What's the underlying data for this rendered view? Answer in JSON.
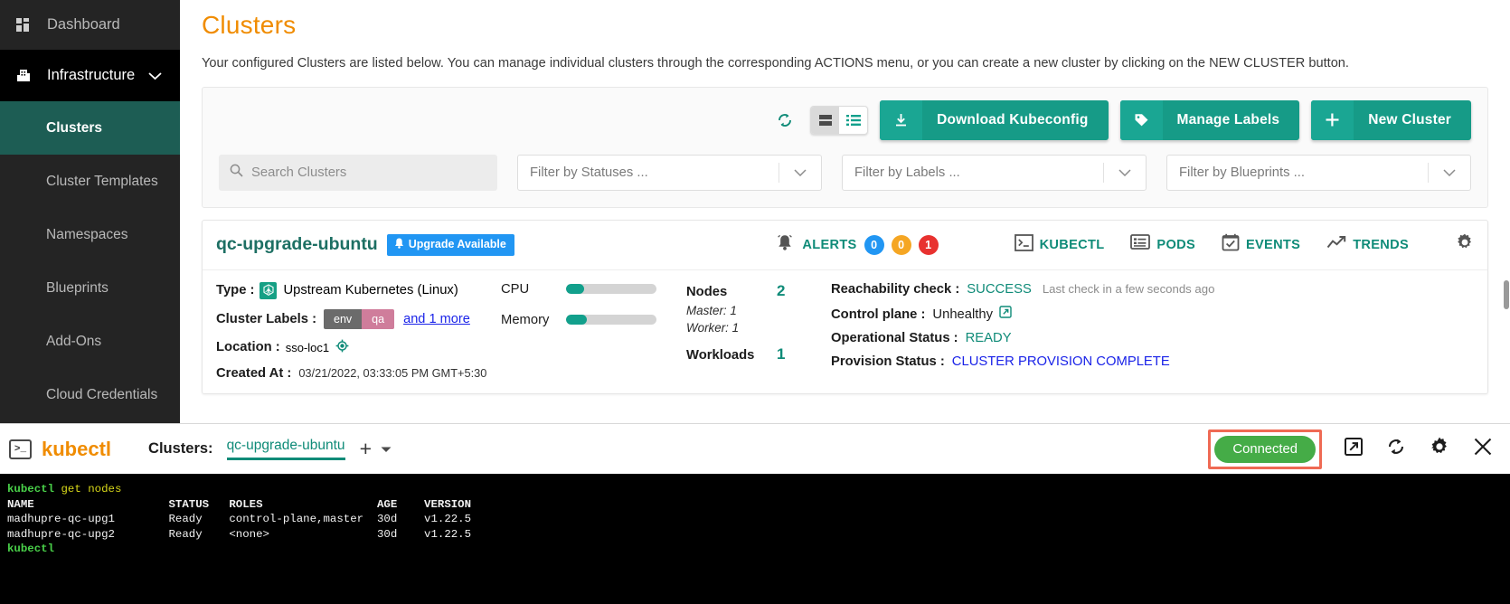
{
  "sidebar": {
    "dashboard": {
      "label": "Dashboard",
      "icon": "grid-icon"
    },
    "infrastructure": {
      "label": "Infrastructure",
      "icon": "building-icon",
      "chevron": "chevron-down-icon"
    },
    "items": [
      {
        "label": "Clusters",
        "active": true
      },
      {
        "label": "Cluster Templates",
        "active": false
      },
      {
        "label": "Namespaces",
        "active": false
      },
      {
        "label": "Blueprints",
        "active": false
      },
      {
        "label": "Add-Ons",
        "active": false
      },
      {
        "label": "Cloud Credentials",
        "active": false
      }
    ]
  },
  "page": {
    "title": "Clusters",
    "description": "Your configured Clusters are listed below. You can manage individual clusters through the corresponding ACTIONS menu, or you can create a new cluster by clicking on the NEW CLUSTER button."
  },
  "toolbar": {
    "refresh_icon": "refresh-icon",
    "view_card_icon": "card-view-icon",
    "view_list_icon": "list-view-icon",
    "buttons": [
      {
        "label": "Download Kubeconfig",
        "icon": "download-icon"
      },
      {
        "label": "Manage Labels",
        "icon": "tag-icon"
      },
      {
        "label": "New Cluster",
        "icon": "plus-icon"
      }
    ]
  },
  "filters": {
    "search_placeholder": "Search Clusters",
    "search_value": "",
    "status_placeholder": "Filter by Statuses ...",
    "labels_placeholder": "Filter by Labels ...",
    "blueprints_placeholder": "Filter by Blueprints ..."
  },
  "cluster": {
    "name": "qc-upgrade-ubuntu",
    "upgrade_badge": "Upgrade Available",
    "alerts_label": "ALERTS",
    "alerts": [
      {
        "count": "0",
        "color": "#2196f3"
      },
      {
        "count": "0",
        "color": "#f5a623"
      },
      {
        "count": "1",
        "color": "#e8312f"
      }
    ],
    "actions": [
      {
        "label": "KUBECTL",
        "icon": "terminal-icon"
      },
      {
        "label": "PODS",
        "icon": "pods-icon"
      },
      {
        "label": "EVENTS",
        "icon": "calendar-check-icon"
      },
      {
        "label": "TRENDS",
        "icon": "trend-line-icon"
      }
    ],
    "settings_icon": "gear-icon",
    "type_key": "Type :",
    "type_value": "Upstream Kubernetes (Linux)",
    "labels_key": "Cluster Labels :",
    "label_chip": {
      "key": "env",
      "value": "qa"
    },
    "labels_more": "and 1 more",
    "location_key": "Location :",
    "location_value": "sso-loc1",
    "location_icon": "target-icon",
    "created_key": "Created At :",
    "created_value": "03/21/2022, 03:33:05 PM GMT+5:30",
    "cpu_label": "CPU",
    "cpu_percent": 20,
    "memory_label": "Memory",
    "memory_percent": 23,
    "nodes_label": "Nodes",
    "nodes_value": "2",
    "master_line": "Master: 1",
    "worker_line": "Worker: 1",
    "workloads_label": "Workloads",
    "workloads_value": "1",
    "reachability_key": "Reachability check :",
    "reachability_value": "SUCCESS",
    "reachability_note": "Last check in a few seconds ago",
    "controlplane_key": "Control plane :",
    "controlplane_value": "Unhealthy",
    "controlplane_icon": "external-link-icon",
    "operational_key": "Operational Status :",
    "operational_value": "READY",
    "provision_key": "Provision Status :",
    "provision_value": "CLUSTER PROVISION COMPLETE"
  },
  "kubectl": {
    "icon": "terminal-icon",
    "title": "kubectl",
    "clusters_label": "Clusters:",
    "active_tab": "qc-upgrade-ubuntu",
    "add_icon": "plus-icon",
    "dropdown_icon": "caret-down-icon",
    "connected_label": "Connected",
    "popout_icon": "external-link-icon",
    "refresh_icon": "refresh-icon",
    "settings_icon": "gear-icon",
    "close_icon": "close-icon",
    "terminal": {
      "prompt_cmd": "kubectl",
      "prompt_args": " get nodes",
      "header": "NAME                    STATUS   ROLES                 AGE    VERSION",
      "rows": [
        "madhupre-qc-upg1        Ready    control-plane,master  30d    v1.22.5",
        "madhupre-qc-upg2        Ready    <none>                30d    v1.22.5"
      ],
      "final_prompt": "kubectl"
    }
  }
}
